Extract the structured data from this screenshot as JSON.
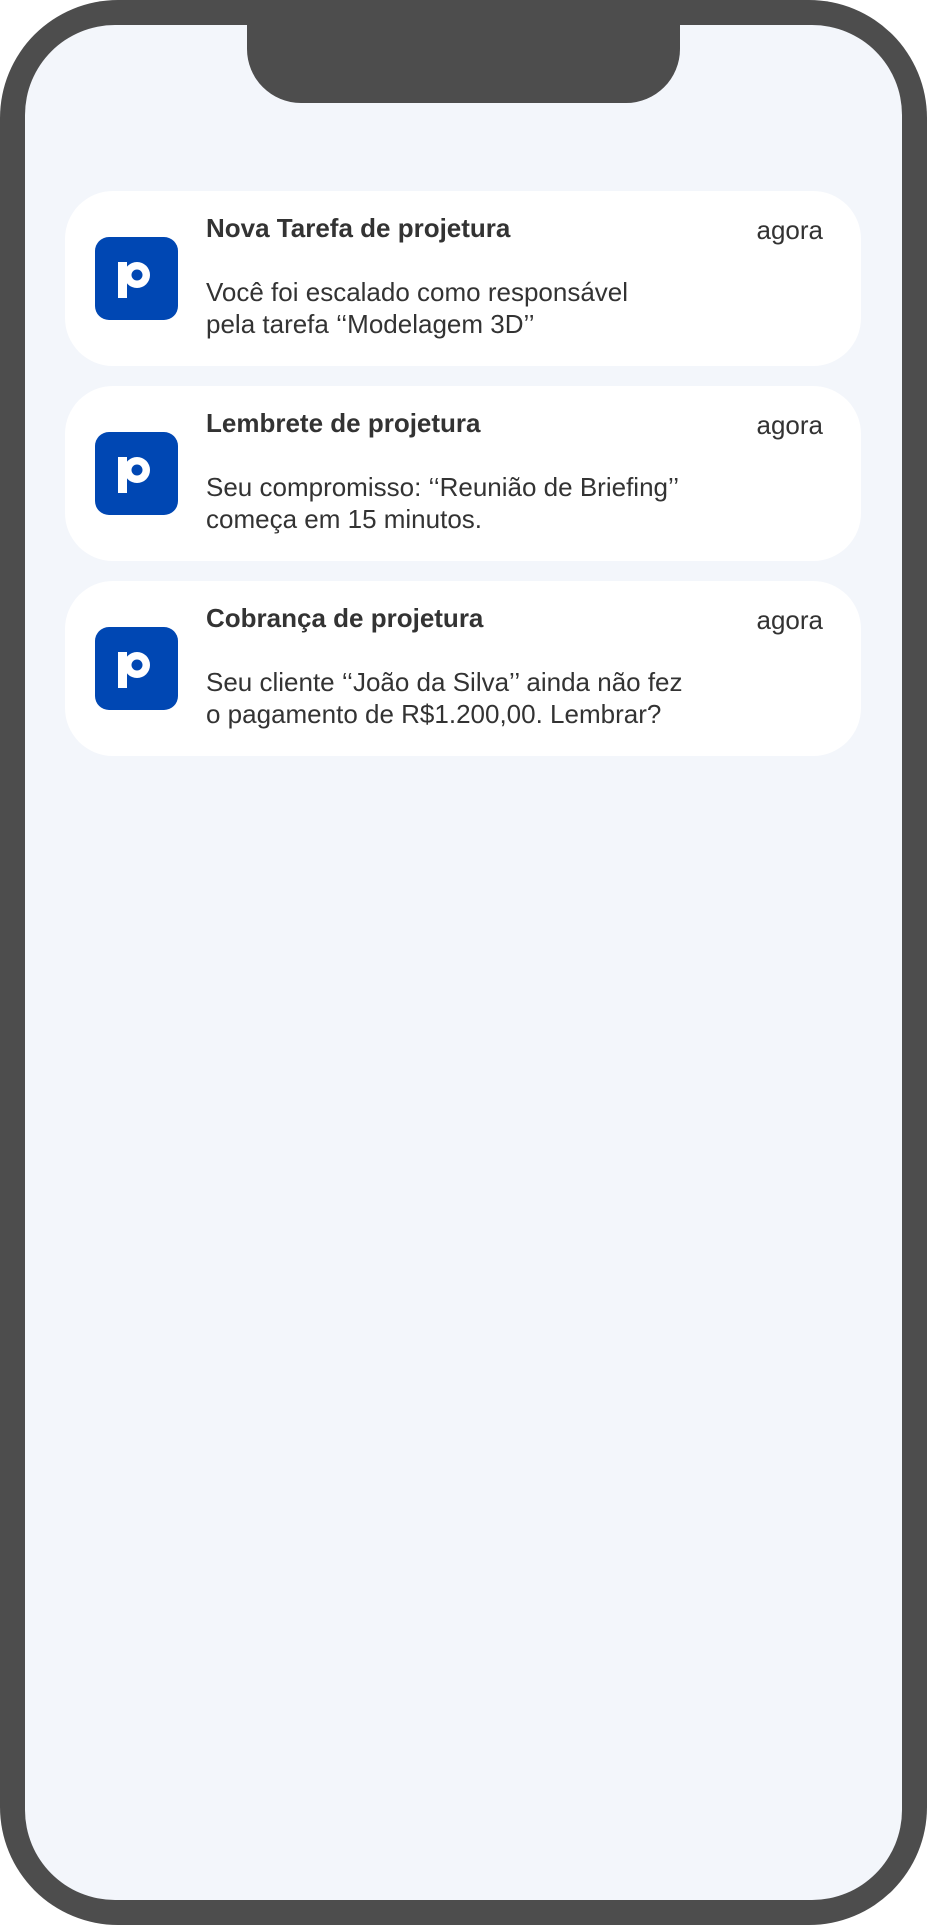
{
  "app": {
    "accent_color": "#0047b3",
    "icon": "projetura-p-logo-icon"
  },
  "notifications": [
    {
      "title": "Nova Tarefa de projetura",
      "time": "agora",
      "body_line1": "Você foi escalado como responsável",
      "body_line2": "pela tarefa ‘‘Modelagem 3D’’"
    },
    {
      "title": "Lembrete de projetura",
      "time": "agora",
      "body_line1": "Seu compromisso: ‘‘Reunião de Briefing’’",
      "body_line2": "começa em 15 minutos."
    },
    {
      "title": "Cobrança de projetura",
      "time": "agora",
      "body_line1": "Seu cliente ‘‘João da Silva’’ ainda não fez",
      "body_line2": "o pagamento de R$1.200,00. Lembrar?"
    }
  ]
}
